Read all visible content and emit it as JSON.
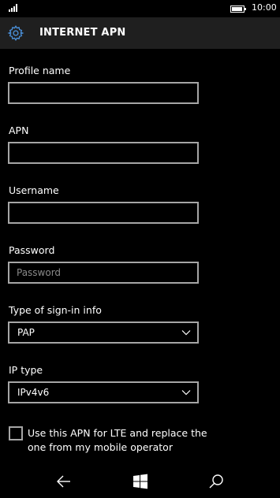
{
  "status_bar": {
    "time": "10:00",
    "signal_icon": "signal-icon",
    "battery_icon": "battery-icon"
  },
  "header": {
    "title": "INTERNET APN",
    "icon": "gear-icon"
  },
  "form": {
    "profile_name": {
      "label": "Profile name",
      "value": "",
      "placeholder": ""
    },
    "apn": {
      "label": "APN",
      "value": "",
      "placeholder": ""
    },
    "username": {
      "label": "Username",
      "value": "",
      "placeholder": ""
    },
    "password": {
      "label": "Password",
      "value": "",
      "placeholder": "Password"
    },
    "sign_in_type": {
      "label": "Type of sign-in info",
      "value": "PAP"
    },
    "ip_type": {
      "label": "IP type",
      "value": "IPv4v6"
    },
    "lte_checkbox": {
      "label": "Use this APN for LTE and replace the one from my mobile operator",
      "checked": false
    }
  },
  "nav_bar": {
    "back_icon": "back-arrow-icon",
    "start_icon": "windows-logo-icon",
    "search_icon": "search-icon"
  },
  "colors": {
    "background": "#000000",
    "header_bg": "#1f1f1f",
    "accent": "#4a8fd8",
    "border": "#a6a6a6"
  }
}
